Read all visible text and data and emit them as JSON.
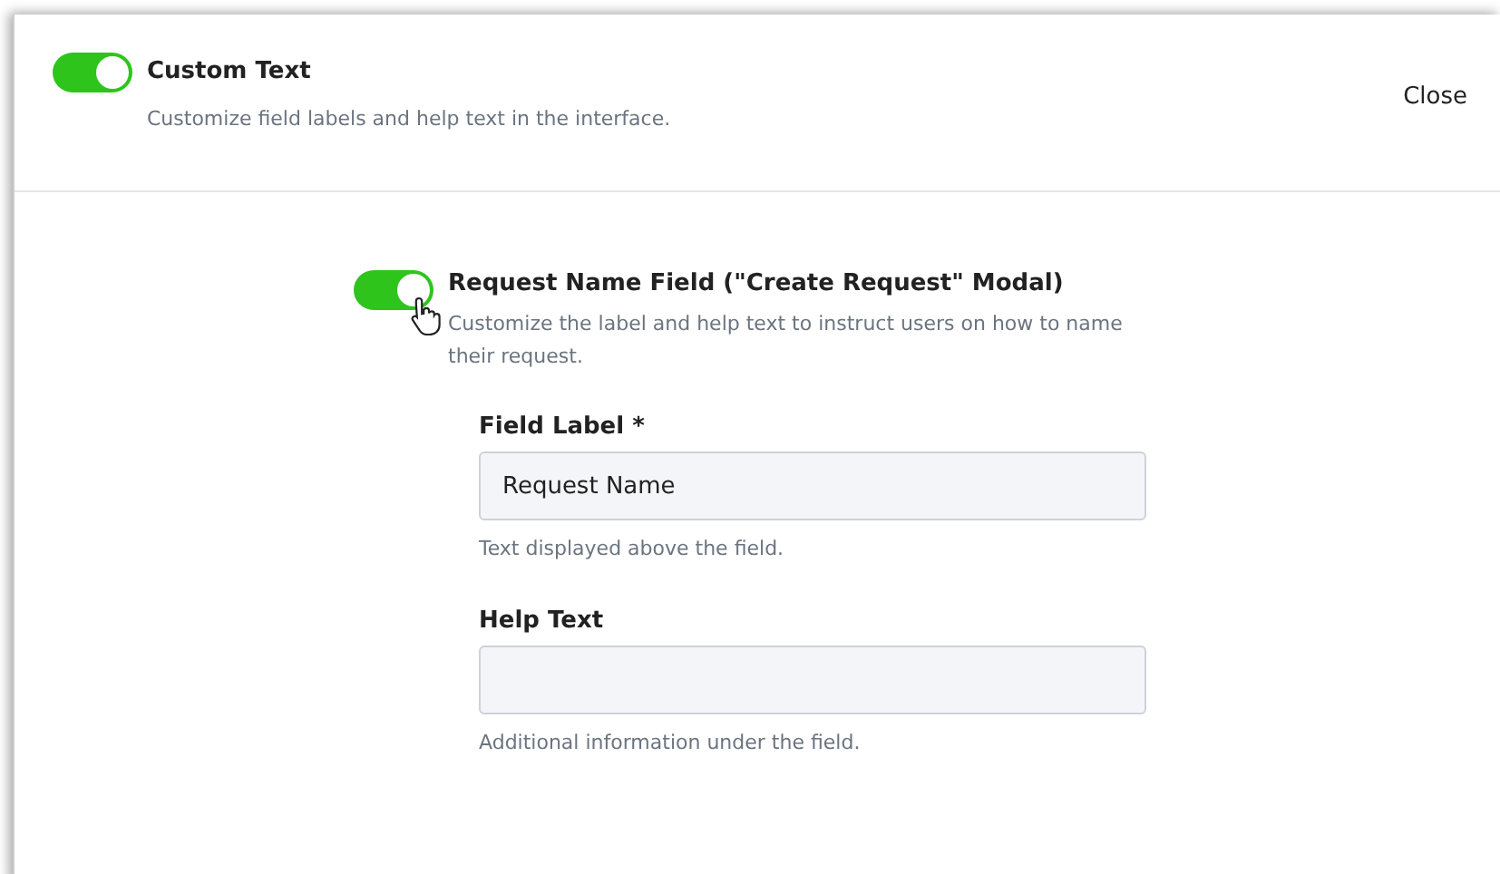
{
  "header": {
    "toggle": {
      "on": true
    },
    "title": "Custom Text",
    "description": "Customize field labels and help text in the interface.",
    "close": "Close"
  },
  "section": {
    "toggle": {
      "on": true
    },
    "title": "Request Name Field (\"Create Request\" Modal)",
    "description": "Customize the label and help text to instruct users on how to name their request.",
    "fields": [
      {
        "label": "Field Label *",
        "value": "Request Name",
        "hint": "Text displayed above the field."
      },
      {
        "label": "Help Text",
        "hint": "Additional information under the field."
      }
    ]
  }
}
